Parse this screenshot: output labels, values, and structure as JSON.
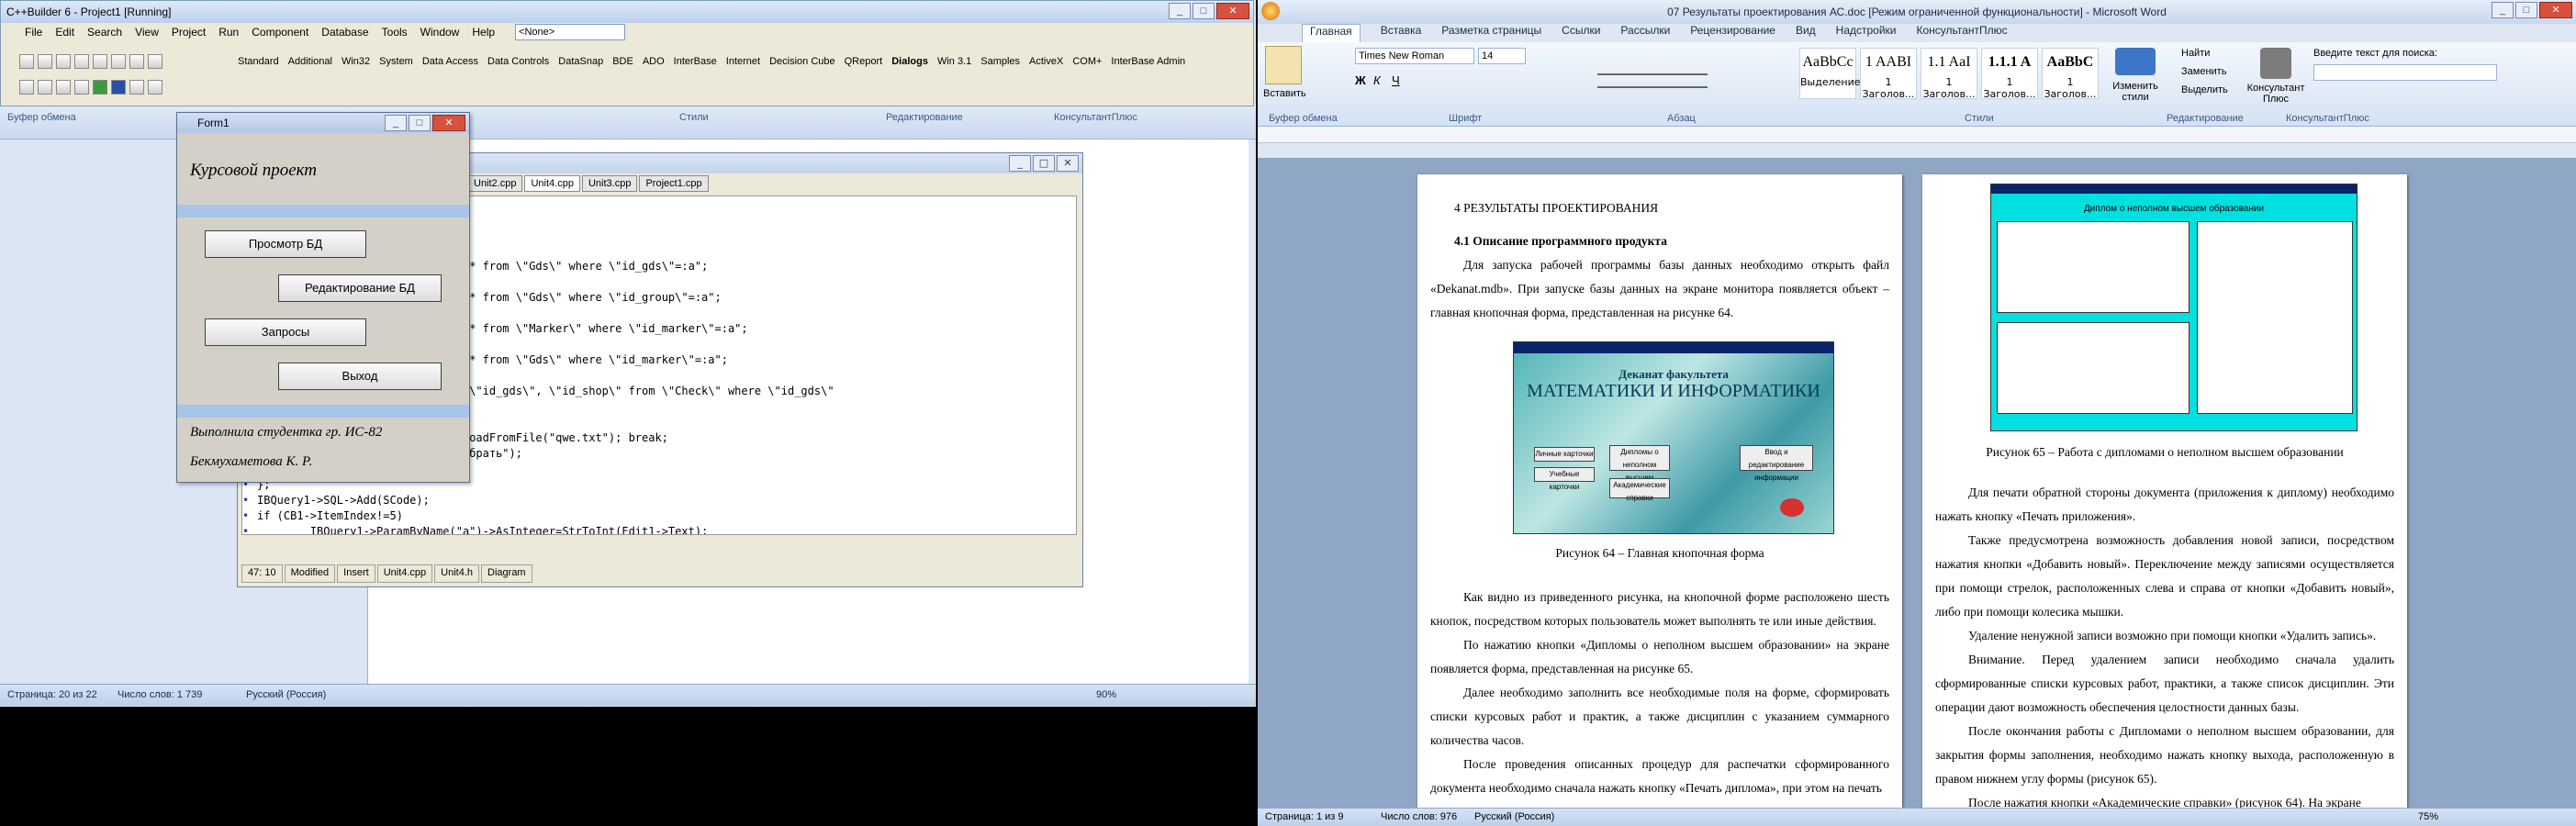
{
  "ide": {
    "title": "C++Builder 6 - Project1 [Running]",
    "menu": [
      "File",
      "Edit",
      "Search",
      "View",
      "Project",
      "Run",
      "Component",
      "Database",
      "Tools",
      "Window",
      "Help"
    ],
    "combo_value": "<None>",
    "palette_tabs": [
      "Standard",
      "Additional",
      "Win32",
      "System",
      "Data Access",
      "Data Controls",
      "DataSnap",
      "BDE",
      "ADO",
      "InterBase",
      "Internet",
      "Decision Cube",
      "QReport",
      "Dialogs",
      "Win 3.1",
      "Samples",
      "ActiveX",
      "COM+",
      "InterBase Admin"
    ]
  },
  "left_ribbon_labels": {
    "clipboard": "Буфер обмена",
    "styles": "Стили",
    "editing": "Редактирование",
    "consultant": "КонсультантПлюс"
  },
  "editor": {
    "tabs": [
      "Unit2.cpp",
      "Unit4.cpp",
      "Unit3.cpp",
      "Project1.cpp"
    ],
    "lines": [
      {
        "t": "IBQuery1->SQL->Clear();"
      },
      {
        "t": "String SCode;"
      },
      {
        "t": "switch(CB1->ItemIndex)"
      },
      {
        "t": "{"
      },
      {
        "t": "        case 0: SCode = \"select * from \\\"Gds\\\" where \\\"id_gds\\\"=:a\";"
      },
      {
        "t": "                break;"
      },
      {
        "t": "        case 1: SCode = \"select * from \\\"Gds\\\" where \\\"id_group\\\"=:a\";"
      },
      {
        "t": "                break;"
      },
      {
        "t": "        case 2: SCode = \"select * from \\\"Marker\\\" where \\\"id_marker\\\"=:a\";"
      },
      {
        "t": "                break;"
      },
      {
        "t": "        case 3: SCode = \"select * from \\\"Gds\\\" where \\\"id_marker\\\"=:a\";"
      },
      {
        "t": "                break;"
      },
      {
        "t": "        case 4: SCode = \"select \\\"id_gds\\\", \\\"id_shop\\\" from \\\"Check\\\" where \\\"id_gds\\\""
      },
      {
        "t": "                break;"
      },
      {
        "t": "        case 5: SCode = \"\";"
      },
      {
        "t": "                IBQuery1->SQL->LoadFromFile(\"qwe.txt\"); break;"
      },
      {
        "t": "        case -1: ShowMessage(\"Выбрать\");"
      },
      {
        "t": "                return;"
      },
      {
        "t": "};"
      },
      {
        "t": "IBQuery1->SQL->Add(SCode);"
      },
      {
        "t": "if (CB1->ItemIndex!=5)"
      },
      {
        "t": "        IBQuery1->ParamByName(\"a\")->AsInteger=StrToInt(Edit1->Text);"
      },
      {
        "t": "IBQuery1->Open();"
      }
    ],
    "status_pos": "47: 10",
    "status_state": "Modified",
    "status_mode": "Insert",
    "bottom_tabs": [
      "Unit4.cpp",
      "Unit4.h",
      "Diagram"
    ]
  },
  "form1": {
    "title": "Form1",
    "heading": "Курсовой проект",
    "btn_view": "Просмотр БД",
    "btn_edit": "Редактирование БД",
    "btn_queries": "Запросы",
    "btn_exit": "Выход",
    "footer1": "Выполнила студентка гр. ИС-82",
    "footer2": "Бекмухаметова К. Р."
  },
  "left_status": {
    "page": "Страница: 20 из 22",
    "words": "Число слов: 1 739",
    "lang": "Русский (Россия)",
    "zoom": "90%"
  },
  "word": {
    "title": "07 Результаты проектирования АС.doc [Режим ограниченной функциональности] - Microsoft Word",
    "tabs": [
      "Главная",
      "Вставка",
      "Разметка страницы",
      "Ссылки",
      "Рассылки",
      "Рецензирование",
      "Вид",
      "Надстройки",
      "КонсультантПлюс"
    ],
    "font_name": "Times New Roman",
    "font_size": "14",
    "paste_label": "Вставить",
    "styles": [
      {
        "sample": "AaBbCc",
        "name": "Выделение"
      },
      {
        "sample": "1 AABI",
        "name": "1 Заголов..."
      },
      {
        "sample": "1.1 AaI",
        "name": "1 Заголов..."
      },
      {
        "sample": "1.1.1 A",
        "name": "1 Заголов..."
      },
      {
        "sample": "AaBbC",
        "name": "1 Заголов..."
      }
    ],
    "change_styles": "Изменить стили",
    "find": "Найти",
    "replace": "Заменить",
    "select": "Выделить",
    "consultant": "Консультант Плюс",
    "help_search": "Введите текст для поиска:",
    "group_labels": [
      "Буфер обмена",
      "Шрифт",
      "Абзац",
      "Стили",
      "Редактирование",
      "КонсультантПлюс"
    ],
    "page1": {
      "h1": "4 РЕЗУЛЬТАТЫ ПРОЕКТИРОВАНИЯ",
      "h2": "4.1 Описание программного продукта",
      "p1": "Для запуска рабочей программы базы данных необходимо открыть файл «Dekanat.mdb». При запуске базы данных на экране монитора появляется объект – главная кнопочная форма, представленная на рисунке 64.",
      "fig_title": "Деканат факультета",
      "fig_sub": "МАТЕМАТИКИ И ИНФОРМАТИКИ",
      "fig_btns": [
        "Личные карточки",
        "Учебные карточки",
        "Дипломы о неполном высшем образовании",
        "Академические справки",
        "Ввод и редактирование информации"
      ],
      "fig_caption": "Рисунок 64 – Главная кнопочная форма",
      "p2": "Как видно из приведенного рисунка, на кнопочной форме расположено шесть кнопок, посредством которых пользователь может выполнять те или иные действия.",
      "p3": "По нажатию кнопки «Дипломы о неполном высшем образовании» на экране появляется форма, представленная на рисунке 65.",
      "p4": "Далее необходимо заполнить все необходимые поля на форме, сформировать списки курсовых работ и практик, а также дисциплин с указанием суммарного количества часов.",
      "p5": "После проведения описанных процедур для распечатки сформированного документа необходимо сначала нажать кнопку «Печать диплома», при этом на печать"
    },
    "page2": {
      "fig_title": "Диплом о неполном высшем образовании",
      "fig_caption": "Рисунок 65 – Работа с дипломами о неполном высшем образовании",
      "p1": "Для печати обратной стороны документа (приложения к диплому) необходимо нажать кнопку «Печать приложения».",
      "p2": "Также предусмотрена возможность добавления новой записи, посредством нажатия кнопки «Добавить новый». Переключение между записями осуществляется при помощи стрелок, расположенных слева и справа от кнопки «Добавить новый», либо при помощи колесика мышки.",
      "p3": "Удаление ненужной записи возможно при помощи кнопки «Удалить запись».",
      "p4": "Внимание. Перед удалением записи необходимо сначала удалить сформированные списки курсовых работ, практики, а также список дисциплин. Эти операции дают возможность обеспечения целостности данных базы.",
      "p5": "После окончания работы с Дипломами о неполном высшем образовании, для закрытия формы заполнения, необходимо нажать кнопку выхода, расположенную в правом нижнем углу формы (рисунок 65).",
      "p6": "После нажатия кнопки «Академические справки» (рисунок 64). На экране"
    },
    "status": {
      "page": "Страница: 1 из 9",
      "words": "Число слов: 976",
      "lang": "Русский (Россия)",
      "zoom": "75%"
    }
  }
}
